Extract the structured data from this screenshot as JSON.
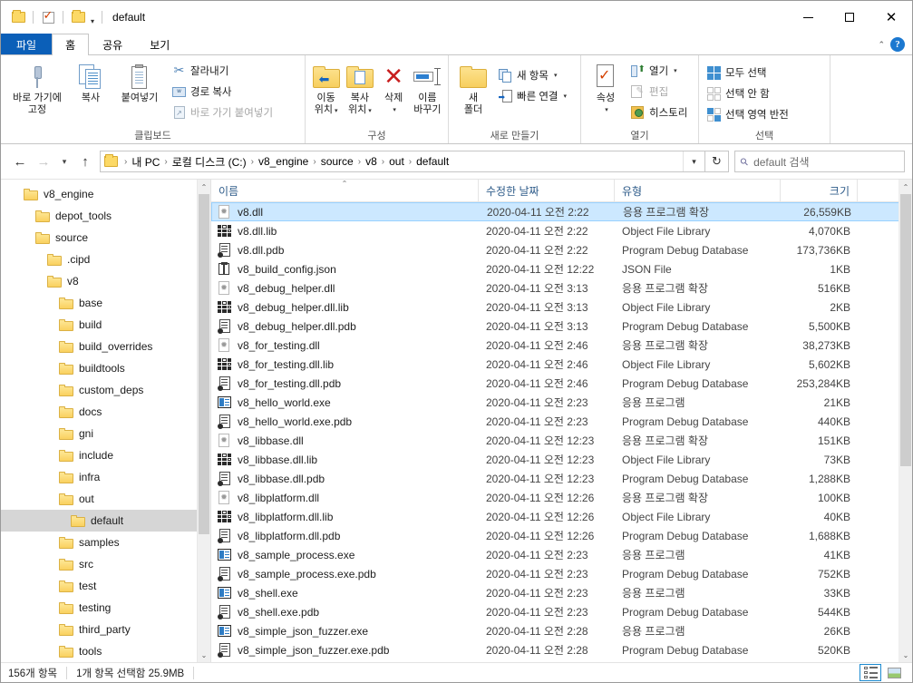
{
  "window": {
    "title": "default",
    "quick_access": {
      "folder_icon": "folder-icon",
      "properties_icon": "properties-checkmark-icon",
      "new_folder_icon": "new-folder-icon",
      "customize_caret": "chevron-down-icon"
    },
    "controls": {
      "minimize": "minimize-icon",
      "maximize": "maximize-icon",
      "close": "close-icon"
    }
  },
  "tabs": [
    {
      "label": "파일",
      "kind": "file"
    },
    {
      "label": "홈",
      "kind": "active"
    },
    {
      "label": "공유",
      "kind": "normal"
    },
    {
      "label": "보기",
      "kind": "normal"
    }
  ],
  "ribbon_right": {
    "collapse": "chevron-up-icon",
    "help": "?"
  },
  "ribbon": {
    "groups": [
      {
        "label": "클립보드",
        "big": [
          {
            "label": "바로 가기에\n고정",
            "icon": "pin-icon",
            "l1": "바로 가기에",
            "l2": "고정"
          },
          {
            "label": "복사",
            "icon": "copy-icon",
            "l1": "복사",
            "l2": ""
          },
          {
            "label": "붙여넣기",
            "icon": "paste-icon",
            "l1": "붙여넣기",
            "l2": ""
          }
        ],
        "small": [
          {
            "label": "잘라내기",
            "icon": "scissors-icon",
            "disabled": false
          },
          {
            "label": "경로 복사",
            "icon": "copy-path-icon",
            "disabled": false
          },
          {
            "label": "바로 가기 붙여넣기",
            "icon": "paste-shortcut-icon",
            "disabled": true
          }
        ]
      },
      {
        "label": "구성",
        "big": [
          {
            "l1": "이동",
            "l2": "위치",
            "icon": "move-to-icon",
            "dropdown": true
          },
          {
            "l1": "복사",
            "l2": "위치",
            "icon": "copy-to-icon",
            "dropdown": true
          },
          {
            "l1": "삭제",
            "l2": "",
            "icon": "delete-x-icon",
            "dropdown": true
          },
          {
            "l1": "이름",
            "l2": "바꾸기",
            "icon": "rename-icon",
            "dropdown": false
          }
        ]
      },
      {
        "label": "새로 만들기",
        "big": [
          {
            "l1": "새",
            "l2": "폴더",
            "icon": "new-folder-icon",
            "dropdown": false
          }
        ],
        "small": [
          {
            "label": "새 항목",
            "icon": "new-item-icon",
            "dropdown": true
          },
          {
            "label": "빠른 연결",
            "icon": "quick-access-link-icon",
            "dropdown": true
          }
        ]
      },
      {
        "label": "열기",
        "big": [
          {
            "l1": "속성",
            "l2": "",
            "icon": "properties-icon",
            "dropdown": true
          }
        ],
        "small": [
          {
            "label": "열기",
            "icon": "open-icon",
            "dropdown": true
          },
          {
            "label": "편집",
            "icon": "edit-icon",
            "disabled": true
          },
          {
            "label": "히스토리",
            "icon": "history-icon"
          }
        ]
      },
      {
        "label": "선택",
        "small": [
          {
            "label": "모두 선택",
            "icon": "select-all-icon"
          },
          {
            "label": "선택 안 함",
            "icon": "select-none-icon"
          },
          {
            "label": "선택 영역 반전",
            "icon": "invert-selection-icon"
          }
        ]
      }
    ]
  },
  "nav": {
    "back": "arrow-left-icon",
    "forward": "arrow-right-icon",
    "recent": "chevron-down-icon",
    "up": "arrow-up-icon",
    "refresh": "refresh-icon",
    "dropdown": "chevron-down-icon",
    "breadcrumbs": [
      "내 PC",
      "로컬 디스크 (C:)",
      "v8_engine",
      "source",
      "v8",
      "out",
      "default"
    ],
    "separator": "›"
  },
  "search": {
    "placeholder": "default 검색",
    "icon": "search-icon"
  },
  "tree": [
    {
      "label": "v8_engine",
      "depth": 1,
      "selected": false
    },
    {
      "label": "depot_tools",
      "depth": 2,
      "selected": false
    },
    {
      "label": "source",
      "depth": 2,
      "selected": false
    },
    {
      "label": ".cipd",
      "depth": 3,
      "selected": false
    },
    {
      "label": "v8",
      "depth": 3,
      "selected": false
    },
    {
      "label": "base",
      "depth": 4,
      "selected": false
    },
    {
      "label": "build",
      "depth": 4,
      "selected": false
    },
    {
      "label": "build_overrides",
      "depth": 4,
      "selected": false
    },
    {
      "label": "buildtools",
      "depth": 4,
      "selected": false
    },
    {
      "label": "custom_deps",
      "depth": 4,
      "selected": false
    },
    {
      "label": "docs",
      "depth": 4,
      "selected": false
    },
    {
      "label": "gni",
      "depth": 4,
      "selected": false
    },
    {
      "label": "include",
      "depth": 4,
      "selected": false
    },
    {
      "label": "infra",
      "depth": 4,
      "selected": false
    },
    {
      "label": "out",
      "depth": 4,
      "selected": false
    },
    {
      "label": "default",
      "depth": 5,
      "selected": true
    },
    {
      "label": "samples",
      "depth": 4,
      "selected": false
    },
    {
      "label": "src",
      "depth": 4,
      "selected": false
    },
    {
      "label": "test",
      "depth": 4,
      "selected": false
    },
    {
      "label": "testing",
      "depth": 4,
      "selected": false
    },
    {
      "label": "third_party",
      "depth": 4,
      "selected": false
    },
    {
      "label": "tools",
      "depth": 4,
      "selected": false
    }
  ],
  "columns": [
    {
      "key": "name",
      "label": "이름",
      "sorted": true,
      "sort_dir": "asc"
    },
    {
      "key": "date",
      "label": "수정한 날짜",
      "sorted": false
    },
    {
      "key": "type",
      "label": "유형",
      "sorted": false
    },
    {
      "key": "size",
      "label": "크기",
      "sorted": false
    }
  ],
  "files": [
    {
      "name": "v8.dll",
      "date": "2020-04-11 오전 2:22",
      "type": "응용 프로그램 확장",
      "size": "26,559KB",
      "icon": "dll",
      "selected": true
    },
    {
      "name": "v8.dll.lib",
      "date": "2020-04-11 오전 2:22",
      "type": "Object File Library",
      "size": "4,070KB",
      "icon": "lib",
      "selected": false
    },
    {
      "name": "v8.dll.pdb",
      "date": "2020-04-11 오전 2:22",
      "type": "Program Debug Database",
      "size": "173,736KB",
      "icon": "pdb",
      "selected": false
    },
    {
      "name": "v8_build_config.json",
      "date": "2020-04-11 오전 12:22",
      "type": "JSON File",
      "size": "1KB",
      "icon": "json",
      "selected": false
    },
    {
      "name": "v8_debug_helper.dll",
      "date": "2020-04-11 오전 3:13",
      "type": "응용 프로그램 확장",
      "size": "516KB",
      "icon": "dll",
      "selected": false
    },
    {
      "name": "v8_debug_helper.dll.lib",
      "date": "2020-04-11 오전 3:13",
      "type": "Object File Library",
      "size": "2KB",
      "icon": "lib",
      "selected": false
    },
    {
      "name": "v8_debug_helper.dll.pdb",
      "date": "2020-04-11 오전 3:13",
      "type": "Program Debug Database",
      "size": "5,500KB",
      "icon": "pdb",
      "selected": false
    },
    {
      "name": "v8_for_testing.dll",
      "date": "2020-04-11 오전 2:46",
      "type": "응용 프로그램 확장",
      "size": "38,273KB",
      "icon": "dll",
      "selected": false
    },
    {
      "name": "v8_for_testing.dll.lib",
      "date": "2020-04-11 오전 2:46",
      "type": "Object File Library",
      "size": "5,602KB",
      "icon": "lib",
      "selected": false
    },
    {
      "name": "v8_for_testing.dll.pdb",
      "date": "2020-04-11 오전 2:46",
      "type": "Program Debug Database",
      "size": "253,284KB",
      "icon": "pdb",
      "selected": false
    },
    {
      "name": "v8_hello_world.exe",
      "date": "2020-04-11 오전 2:23",
      "type": "응용 프로그램",
      "size": "21KB",
      "icon": "exe",
      "selected": false
    },
    {
      "name": "v8_hello_world.exe.pdb",
      "date": "2020-04-11 오전 2:23",
      "type": "Program Debug Database",
      "size": "440KB",
      "icon": "pdb",
      "selected": false
    },
    {
      "name": "v8_libbase.dll",
      "date": "2020-04-11 오전 12:23",
      "type": "응용 프로그램 확장",
      "size": "151KB",
      "icon": "dll",
      "selected": false
    },
    {
      "name": "v8_libbase.dll.lib",
      "date": "2020-04-11 오전 12:23",
      "type": "Object File Library",
      "size": "73KB",
      "icon": "lib",
      "selected": false
    },
    {
      "name": "v8_libbase.dll.pdb",
      "date": "2020-04-11 오전 12:23",
      "type": "Program Debug Database",
      "size": "1,288KB",
      "icon": "pdb",
      "selected": false
    },
    {
      "name": "v8_libplatform.dll",
      "date": "2020-04-11 오전 12:26",
      "type": "응용 프로그램 확장",
      "size": "100KB",
      "icon": "dll",
      "selected": false
    },
    {
      "name": "v8_libplatform.dll.lib",
      "date": "2020-04-11 오전 12:26",
      "type": "Object File Library",
      "size": "40KB",
      "icon": "lib",
      "selected": false
    },
    {
      "name": "v8_libplatform.dll.pdb",
      "date": "2020-04-11 오전 12:26",
      "type": "Program Debug Database",
      "size": "1,688KB",
      "icon": "pdb",
      "selected": false
    },
    {
      "name": "v8_sample_process.exe",
      "date": "2020-04-11 오전 2:23",
      "type": "응용 프로그램",
      "size": "41KB",
      "icon": "exe",
      "selected": false
    },
    {
      "name": "v8_sample_process.exe.pdb",
      "date": "2020-04-11 오전 2:23",
      "type": "Program Debug Database",
      "size": "752KB",
      "icon": "pdb",
      "selected": false
    },
    {
      "name": "v8_shell.exe",
      "date": "2020-04-11 오전 2:23",
      "type": "응용 프로그램",
      "size": "33KB",
      "icon": "exe",
      "selected": false
    },
    {
      "name": "v8_shell.exe.pdb",
      "date": "2020-04-11 오전 2:23",
      "type": "Program Debug Database",
      "size": "544KB",
      "icon": "pdb",
      "selected": false
    },
    {
      "name": "v8_simple_json_fuzzer.exe",
      "date": "2020-04-11 오전 2:28",
      "type": "응용 프로그램",
      "size": "26KB",
      "icon": "exe",
      "selected": false
    },
    {
      "name": "v8_simple_json_fuzzer.exe.pdb",
      "date": "2020-04-11 오전 2:28",
      "type": "Program Debug Database",
      "size": "520KB",
      "icon": "pdb",
      "selected": false
    }
  ],
  "status": {
    "item_count": "156개 항목",
    "selection": "1개 항목 선택함 25.9MB",
    "view_details": "details-view-icon",
    "view_tiles": "large-icons-view-icon"
  },
  "colors": {
    "accent": "#0b5fb8",
    "selection": "#cce8ff",
    "folder": "#fad15f",
    "help": "#1b78d0"
  }
}
